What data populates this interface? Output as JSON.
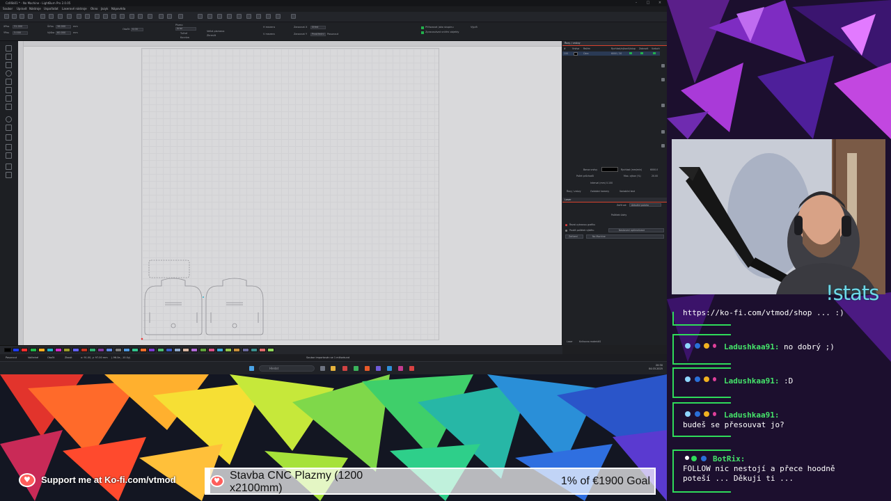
{
  "app": {
    "title": "Cz06b01 * - No Machine - LightBurn Pro 2.0.05",
    "menu": [
      "Soubor",
      "Upravit",
      "Nástroje",
      "Uspořádat",
      "Laserové nástroje",
      "Okno",
      "Jazyk",
      "Nápověda"
    ],
    "toolbar2": {
      "xpos_label": "XPos",
      "xpos_value": "31.000",
      "ypos_label": "YPos",
      "ypos_value": "3.000",
      "width_label": "Šířka",
      "width_value": "38.000",
      "height_label": "Výška",
      "height_value": "60.000",
      "unit": "mm",
      "rotate_label": "Otočit",
      "rotate_value": "0.00",
      "font_label": "Písmo",
      "font_value": "Arial",
      "bold_label": "Tučné",
      "italic_label": "Kurzíva",
      "upper_label": "Velká písmena",
      "distort_label": "Zkreslit",
      "hspace_label": "H mezera",
      "vspace_label": "V mezera",
      "align_x_label": "Zarovnat X",
      "align_x_value": "Střed",
      "align_y_label": "Zarovnat Y",
      "align_y_value": "Prostřední",
      "offset_label": "Posunout",
      "weld_label": "Přiřazovat jako skupinu",
      "weld2_label": "Zpracovávat vnitřní objekty",
      "weld3_label": "Výplň"
    },
    "right_panel": {
      "cuts_header": "Řezy / vrstvy",
      "col_headers": [
        "#",
        "Vrstva",
        "Režim",
        "Rychlost/výkon",
        "Výstup",
        "Zobrazit",
        "Vzduch"
      ],
      "row": {
        "num": "C00",
        "mode": "Čára",
        "speed_power": "6000 / 20"
      },
      "layer_color_label": "Barva vrstvy",
      "passes_label": "Počet průchodů",
      "interval_label": "Interval (mm)",
      "interval_value": "0.100",
      "speed_label": "Rychlost (mm/min)",
      "speed_value": "6000.0",
      "power_label": "Max. výkon (%)",
      "power_value": "20.00",
      "subtabs": [
        "Řezy / vrstvy",
        "Ovládání kamery",
        "Variabilní text"
      ],
      "laser_header": "Laser",
      "start_from_label": "Začít od:",
      "start_from_value": "Aktuální poloha",
      "job_origin_label": "Počátek úlohy",
      "cut_selected_label": "Řezat vybranou grafiku",
      "use_selection_label": "Použít počátek výběru",
      "optimization_label": "Nastavení optimalizace",
      "devices_label": "Zařízení",
      "device_value": "No Machine",
      "bottom_tabs": [
        "Laser",
        "Knihovna materiálů"
      ]
    },
    "status": {
      "move_label": "Posunout",
      "free_label": "Volitelné",
      "rotate_label": "Otočit",
      "shear_label": "Zkosit",
      "coords": "x: 91.00, y: 97.00 mm",
      "coords2": "(-96.0e, -10.0y)",
      "message": "Soubor importován se 1 milisekund"
    },
    "taskbar": {
      "search_placeholder": "Hledat",
      "time": "20:30",
      "date": "04.03.2025"
    },
    "palette_colors": [
      "#000000",
      "#1f3cff",
      "#ff2d2d",
      "#20b648",
      "#ffad1f",
      "#1fb0c4",
      "#d12cc9",
      "#9a9a2b",
      "#6262ff",
      "#c4321f",
      "#2fa86c",
      "#7f3a9c",
      "#5a86e0",
      "#7a7a7a",
      "#4e98e0",
      "#32c48e",
      "#f06d2a",
      "#7a3bd1",
      "#4cbb6e",
      "#3b5bc4",
      "#8ea8c9",
      "#d9b6a2",
      "#b16bd8",
      "#5ea23b",
      "#d84f84",
      "#3ba7d8",
      "#94c64a",
      "#c98f3b",
      "#6b6b9e",
      "#3a8f8f",
      "#dd6b6b",
      "#8fd85a"
    ]
  },
  "stream": {
    "stats_command": "!stats",
    "chat": [
      {
        "user": "",
        "text": "https://ko-fi.com/vtmod/shop ... :)"
      },
      {
        "user": "Ladushkaa91:",
        "text": "no dobrý ;)"
      },
      {
        "user": "Ladushkaa91:",
        "text": ":D"
      },
      {
        "user": "Ladushkaa91:",
        "text": "budeš se přesouvat jo?"
      },
      {
        "user": "BotRix:",
        "text": "FOLLOW nic nestojí a přece hoodně",
        "text2": "poteší ... Děkuji ti ..."
      }
    ],
    "kofi_support": "Support me at Ko-fi.com/vtmod",
    "goal_title": "Stavba CNC Plazmy (1200 x2100mm)",
    "goal_percent_text": "1% of €1900 Goal",
    "goal_progress": 0.01,
    "accent_green": "#2fdc5a",
    "kofi_red": "#ff5e5b"
  }
}
